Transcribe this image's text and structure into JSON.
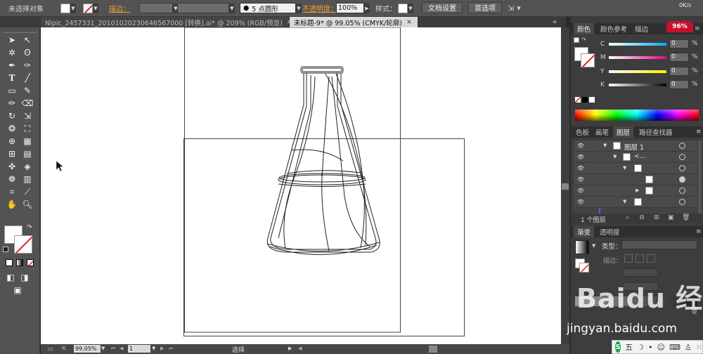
{
  "control_bar": {
    "selection_label": "未选择对象",
    "stroke_label": "描边：",
    "brush_label": "5 点圆形",
    "opacity_label": "不透明度：",
    "opacity_value": "100%",
    "style_label": "样式：",
    "doc_setup_button": "文档设置",
    "prefs_button": "首选项"
  },
  "document_tabs": [
    {
      "label": "Nipic_2457331_20101020230646567000 [转换].ai* @ 209% (RGB/预览)",
      "close": "×"
    },
    {
      "label": "未标题-9* @ 99.05% (CMYK/轮廓)",
      "close": "×"
    }
  ],
  "badge": {
    "percent": "96%",
    "top_right": "0K/s"
  },
  "color_panel": {
    "tabs": [
      "颜色",
      "颜色参考",
      "描边"
    ],
    "channels": [
      {
        "label": "C",
        "value": "0",
        "unit": "%"
      },
      {
        "label": "M",
        "value": "0",
        "unit": "%"
      },
      {
        "label": "Y",
        "value": "0",
        "unit": "%"
      },
      {
        "label": "K",
        "value": "0",
        "unit": "%"
      }
    ]
  },
  "layers_panel": {
    "tabs": [
      "色板",
      "画笔",
      "图层",
      "路径查找器"
    ],
    "layer_name": "图层 1",
    "sublayer": "<...",
    "footer_count": "1 个图层"
  },
  "gradient_panel": {
    "tabs": [
      "渐变",
      "透明度"
    ],
    "type_label": "类型：",
    "stroke_label": "描边："
  },
  "status_bar": {
    "zoom": "99.05%",
    "page": "1",
    "tool": "选择"
  },
  "watermark": {
    "text1": "Baidu 经验",
    "text2": "jingyan.baidu.com"
  },
  "taskbar": {
    "ime": "五"
  },
  "colors": {
    "accent_orange": "#f0a030",
    "canvas": "#ffffff",
    "ui_dark": "#535353"
  }
}
